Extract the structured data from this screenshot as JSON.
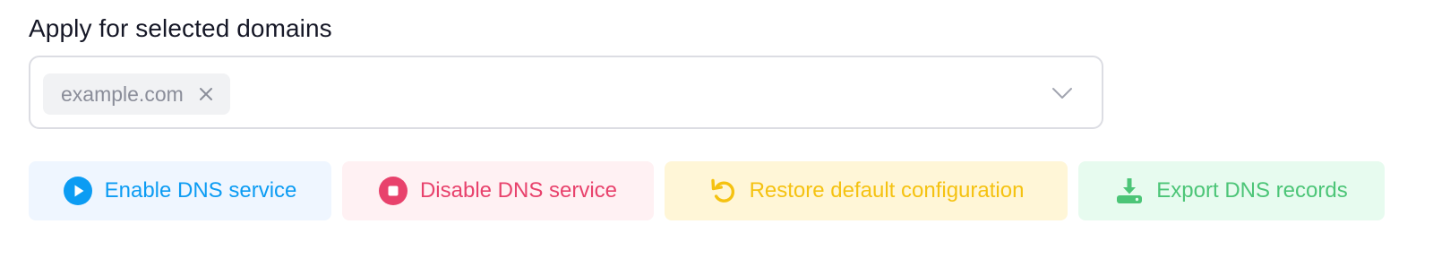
{
  "section": {
    "title": "Apply for selected domains"
  },
  "domain_select": {
    "selected_tags": [
      {
        "label": "example.com",
        "remove_icon": "close-icon"
      }
    ],
    "dropdown_icon": "chevron-down-icon",
    "border_color": "#dcdde3"
  },
  "actions": {
    "enable": {
      "label": "Enable DNS service",
      "icon": "play-circle-icon",
      "color": "#0c9cf3",
      "background": "#eff6ff"
    },
    "disable": {
      "label": "Disable DNS service",
      "icon": "stop-circle-icon",
      "color": "#e8426c",
      "background": "#fff1f3"
    },
    "restore": {
      "label": "Restore default configuration",
      "icon": "restore-icon",
      "color": "#f5c211",
      "background": "#fff6d7"
    },
    "export": {
      "label": "Export DNS records",
      "icon": "download-icon",
      "color": "#4cc577",
      "background": "#e7fbef"
    }
  }
}
